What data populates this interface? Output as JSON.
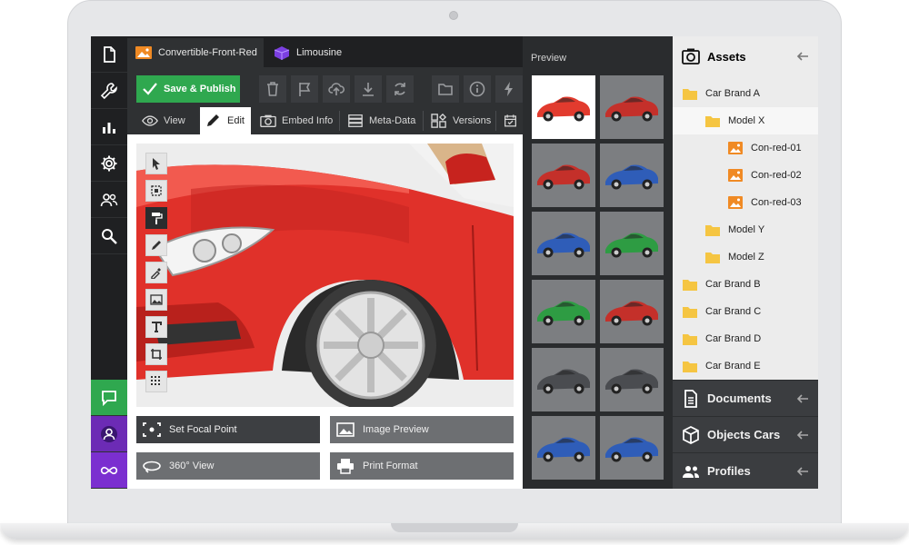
{
  "tabs": [
    {
      "label": "Convertible-Front-Red",
      "icon": "image-icon"
    },
    {
      "label": "Limousine",
      "icon": "cube-icon"
    }
  ],
  "toolbar": {
    "save_label": "Save & Publish",
    "tools": [
      "trash-icon",
      "flag-icon",
      "upload-icon",
      "download-icon",
      "refresh-icon",
      "folder-icon",
      "info-icon",
      "bolt-icon"
    ]
  },
  "modes": [
    {
      "label": "View",
      "icon": "eye-icon"
    },
    {
      "label": "Edit",
      "icon": "pencil-icon"
    },
    {
      "label": "Embed Info",
      "icon": "camera-icon"
    },
    {
      "label": "Meta-Data",
      "icon": "database-icon"
    },
    {
      "label": "Versions",
      "icon": "versions-icon"
    },
    {
      "label": "",
      "icon": "calendar-check-icon"
    }
  ],
  "editor_tools": [
    "cursor-icon",
    "select-box-icon",
    "paint-roller-icon",
    "pencil-icon",
    "eyedropper-icon",
    "image-icon",
    "text-icon",
    "crop-icon",
    "grid-icon"
  ],
  "actions": {
    "focal": "Set Focal Point",
    "preview": "Image Preview",
    "view360": "360° View",
    "print": "Print Format"
  },
  "preview": {
    "title": "Preview",
    "thumbs": [
      "#e23b2e",
      "#c4302a",
      "#c4302a",
      "#2f5db8",
      "#2f5db8",
      "#2e9c43",
      "#2e9c43",
      "#c4302a",
      "#4a4c50",
      "#4a4c50",
      "#2f5db8",
      "#2f5db8"
    ]
  },
  "assets": {
    "title": "Assets",
    "tree": [
      {
        "label": "Car Brand A",
        "type": "folder",
        "level": 0
      },
      {
        "label": "Model X",
        "type": "folder",
        "level": 1
      },
      {
        "label": "Con-red-01",
        "type": "image",
        "level": 2
      },
      {
        "label": "Con-red-02",
        "type": "image",
        "level": 2
      },
      {
        "label": "Con-red-03",
        "type": "image",
        "level": 2
      },
      {
        "label": "Model Y",
        "type": "folder",
        "level": 1
      },
      {
        "label": "Model Z",
        "type": "folder",
        "level": 1
      },
      {
        "label": "Car Brand B",
        "type": "folder",
        "level": 0
      },
      {
        "label": "Car Brand C",
        "type": "folder",
        "level": 0
      },
      {
        "label": "Car Brand D",
        "type": "folder",
        "level": 0
      },
      {
        "label": "Car Brand E",
        "type": "folder",
        "level": 0
      }
    ],
    "sections": [
      {
        "label": "Documents",
        "icon": "document-icon"
      },
      {
        "label": "Objects Cars",
        "icon": "box-icon"
      },
      {
        "label": "Profiles",
        "icon": "users-icon"
      }
    ]
  },
  "sidebar": {
    "items": [
      "file-icon",
      "wrench-icon",
      "chart-icon",
      "gear-icon",
      "users-icon",
      "search-icon"
    ],
    "bottom": [
      "chat-icon",
      "user-icon",
      "infinity-icon"
    ]
  },
  "colors": {
    "save": "#2fa84f",
    "chat": "#2fa84f",
    "user": "#6c2bb5",
    "infinity": "#7b2fd0",
    "folder": "#f5c542",
    "image_file": "#f08a24"
  }
}
